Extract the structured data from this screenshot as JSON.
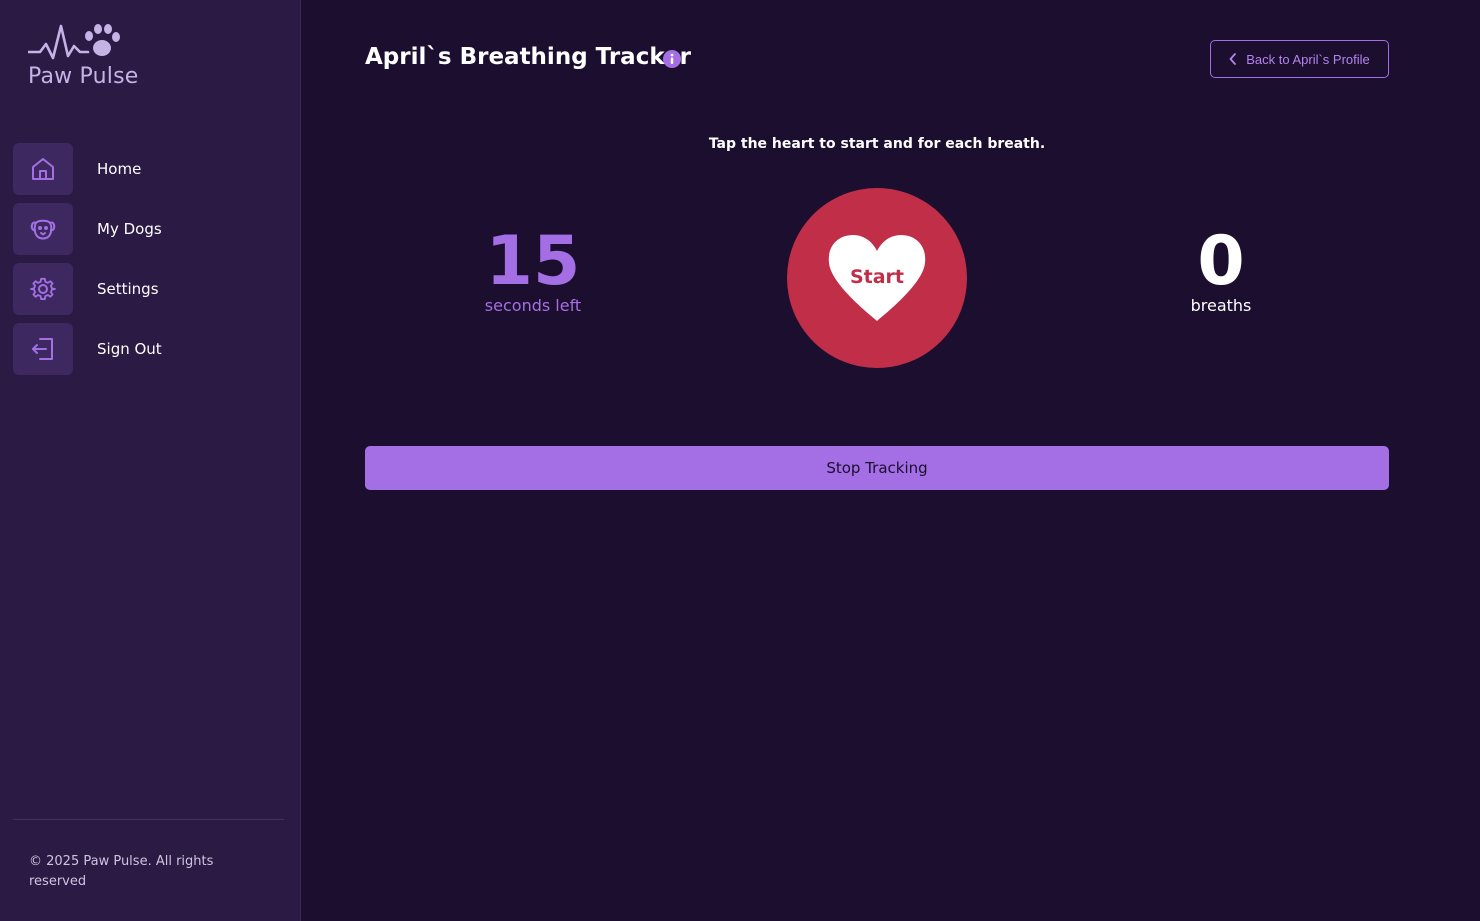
{
  "brand": {
    "name": "Paw Pulse",
    "accent": "#a46ee4",
    "logo_icon": "heartbeat-paw-icon"
  },
  "sidebar": {
    "items": [
      {
        "label": "Home",
        "icon": "home-icon"
      },
      {
        "label": "My Dogs",
        "icon": "dog-face-icon"
      },
      {
        "label": "Settings",
        "icon": "gear-icon"
      },
      {
        "label": "Sign Out",
        "icon": "sign-out-icon"
      }
    ],
    "copyright": "© 2025 Paw Pulse. All rights reserved"
  },
  "header": {
    "title": "April`s Breathing Tracker",
    "info_icon": "info-icon",
    "back_label": "Back to April`s Profile"
  },
  "tracker": {
    "instruction": "Tap the heart to start and for each breath.",
    "seconds_left": "15",
    "seconds_label": "seconds left",
    "heart_label": "Start",
    "heart_color": "#c02e48",
    "breaths_count": "0",
    "breaths_label": "breaths",
    "stop_label": "Stop Tracking"
  }
}
